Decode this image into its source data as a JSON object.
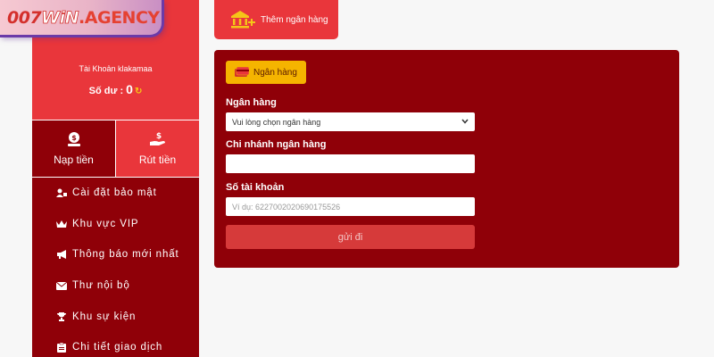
{
  "logo": {
    "part1": "007",
    "part2": "WiN",
    "part3": ".AGENCY"
  },
  "profile": {
    "account_label": "Tài Khoản klakamaa",
    "balance_label": "Số dư :",
    "balance_value": "0",
    "refresh_icon": "refresh-icon"
  },
  "actions": {
    "deposit_label": "Nạp tiền",
    "withdraw_label": "Rút tiền"
  },
  "menu": {
    "items": [
      {
        "label": "Cài đặt bảo mật",
        "icon": "user-lock-icon"
      },
      {
        "label": "Khu vực VIP",
        "icon": "crown-icon"
      },
      {
        "label": "Thông báo mới nhất",
        "icon": "megaphone-icon"
      },
      {
        "label": "Thư nội bộ",
        "icon": "envelope-icon"
      },
      {
        "label": "Khu sự kiện",
        "icon": "trophy-icon"
      },
      {
        "label": "Chi tiết giao dịch",
        "icon": "clipboard-icon"
      }
    ]
  },
  "header": {
    "add_bank_label": "Thêm ngân hàng"
  },
  "form": {
    "tab_label": "Ngân hàng",
    "bank_label": "Ngân hàng",
    "bank_select_value": "Vui lòng chọn ngân hàng",
    "branch_label": "Chi nhánh ngân hàng",
    "branch_value": "",
    "account_number_label": "Số tài khoản",
    "account_number_placeholder": "Ví dụ: 6227002020690175526",
    "submit_label": "gửi đi"
  },
  "colors": {
    "primary_red": "#e9363b",
    "dark_red": "#8f0008",
    "accent_yellow": "#f5b400"
  }
}
